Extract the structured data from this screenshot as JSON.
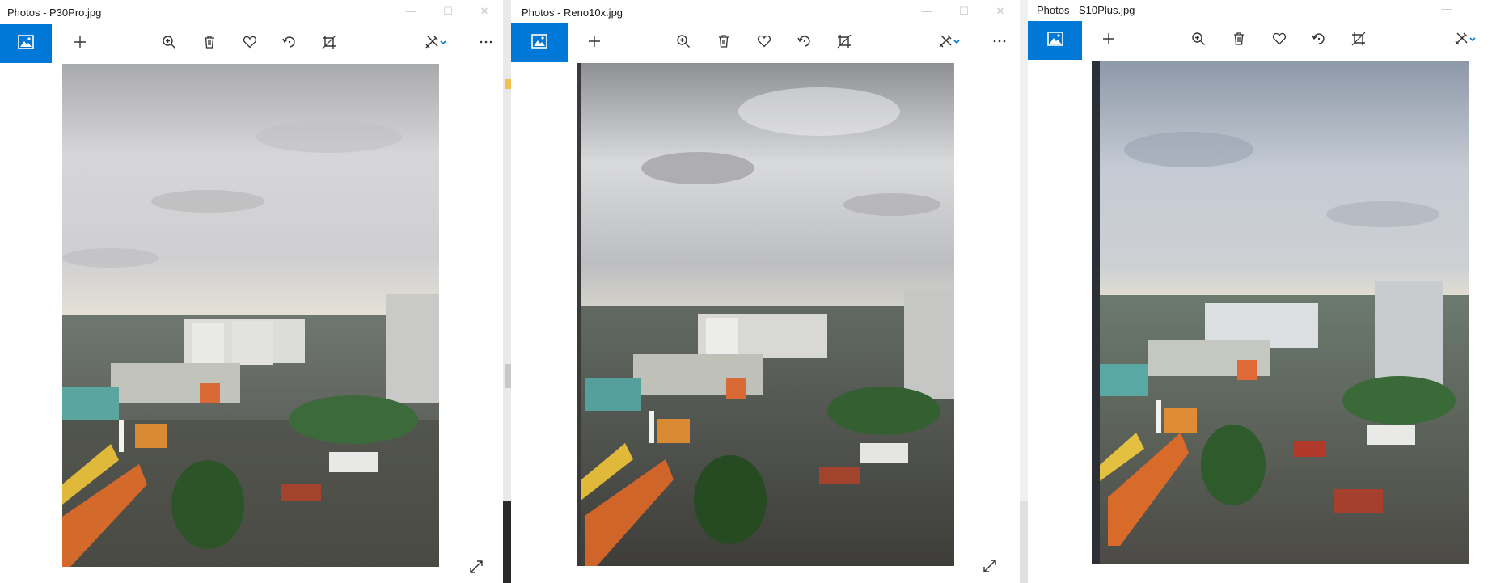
{
  "windows": [
    {
      "title": "Photos - P30Pro.jpg"
    },
    {
      "title": "Photos - Reno10x.jpg"
    },
    {
      "title": "Photos - S10Plus.jpg"
    }
  ],
  "window_controls": {
    "minimize": "—",
    "maximize": "☐",
    "close": "✕"
  },
  "icons": {
    "collection": "collection-photos-icon",
    "add": "plus-icon",
    "zoom": "zoom-in-icon",
    "delete": "trash-icon",
    "favorite": "heart-icon",
    "rotate": "rotate-icon",
    "crop": "crop-icon",
    "edit": "edit-create-icon",
    "more": "more-ellipsis-icon",
    "fullscreen": "expand-icon"
  },
  "colors": {
    "accent": "#0078d7",
    "titlebar": "#ffffff",
    "icon": "#333333"
  }
}
